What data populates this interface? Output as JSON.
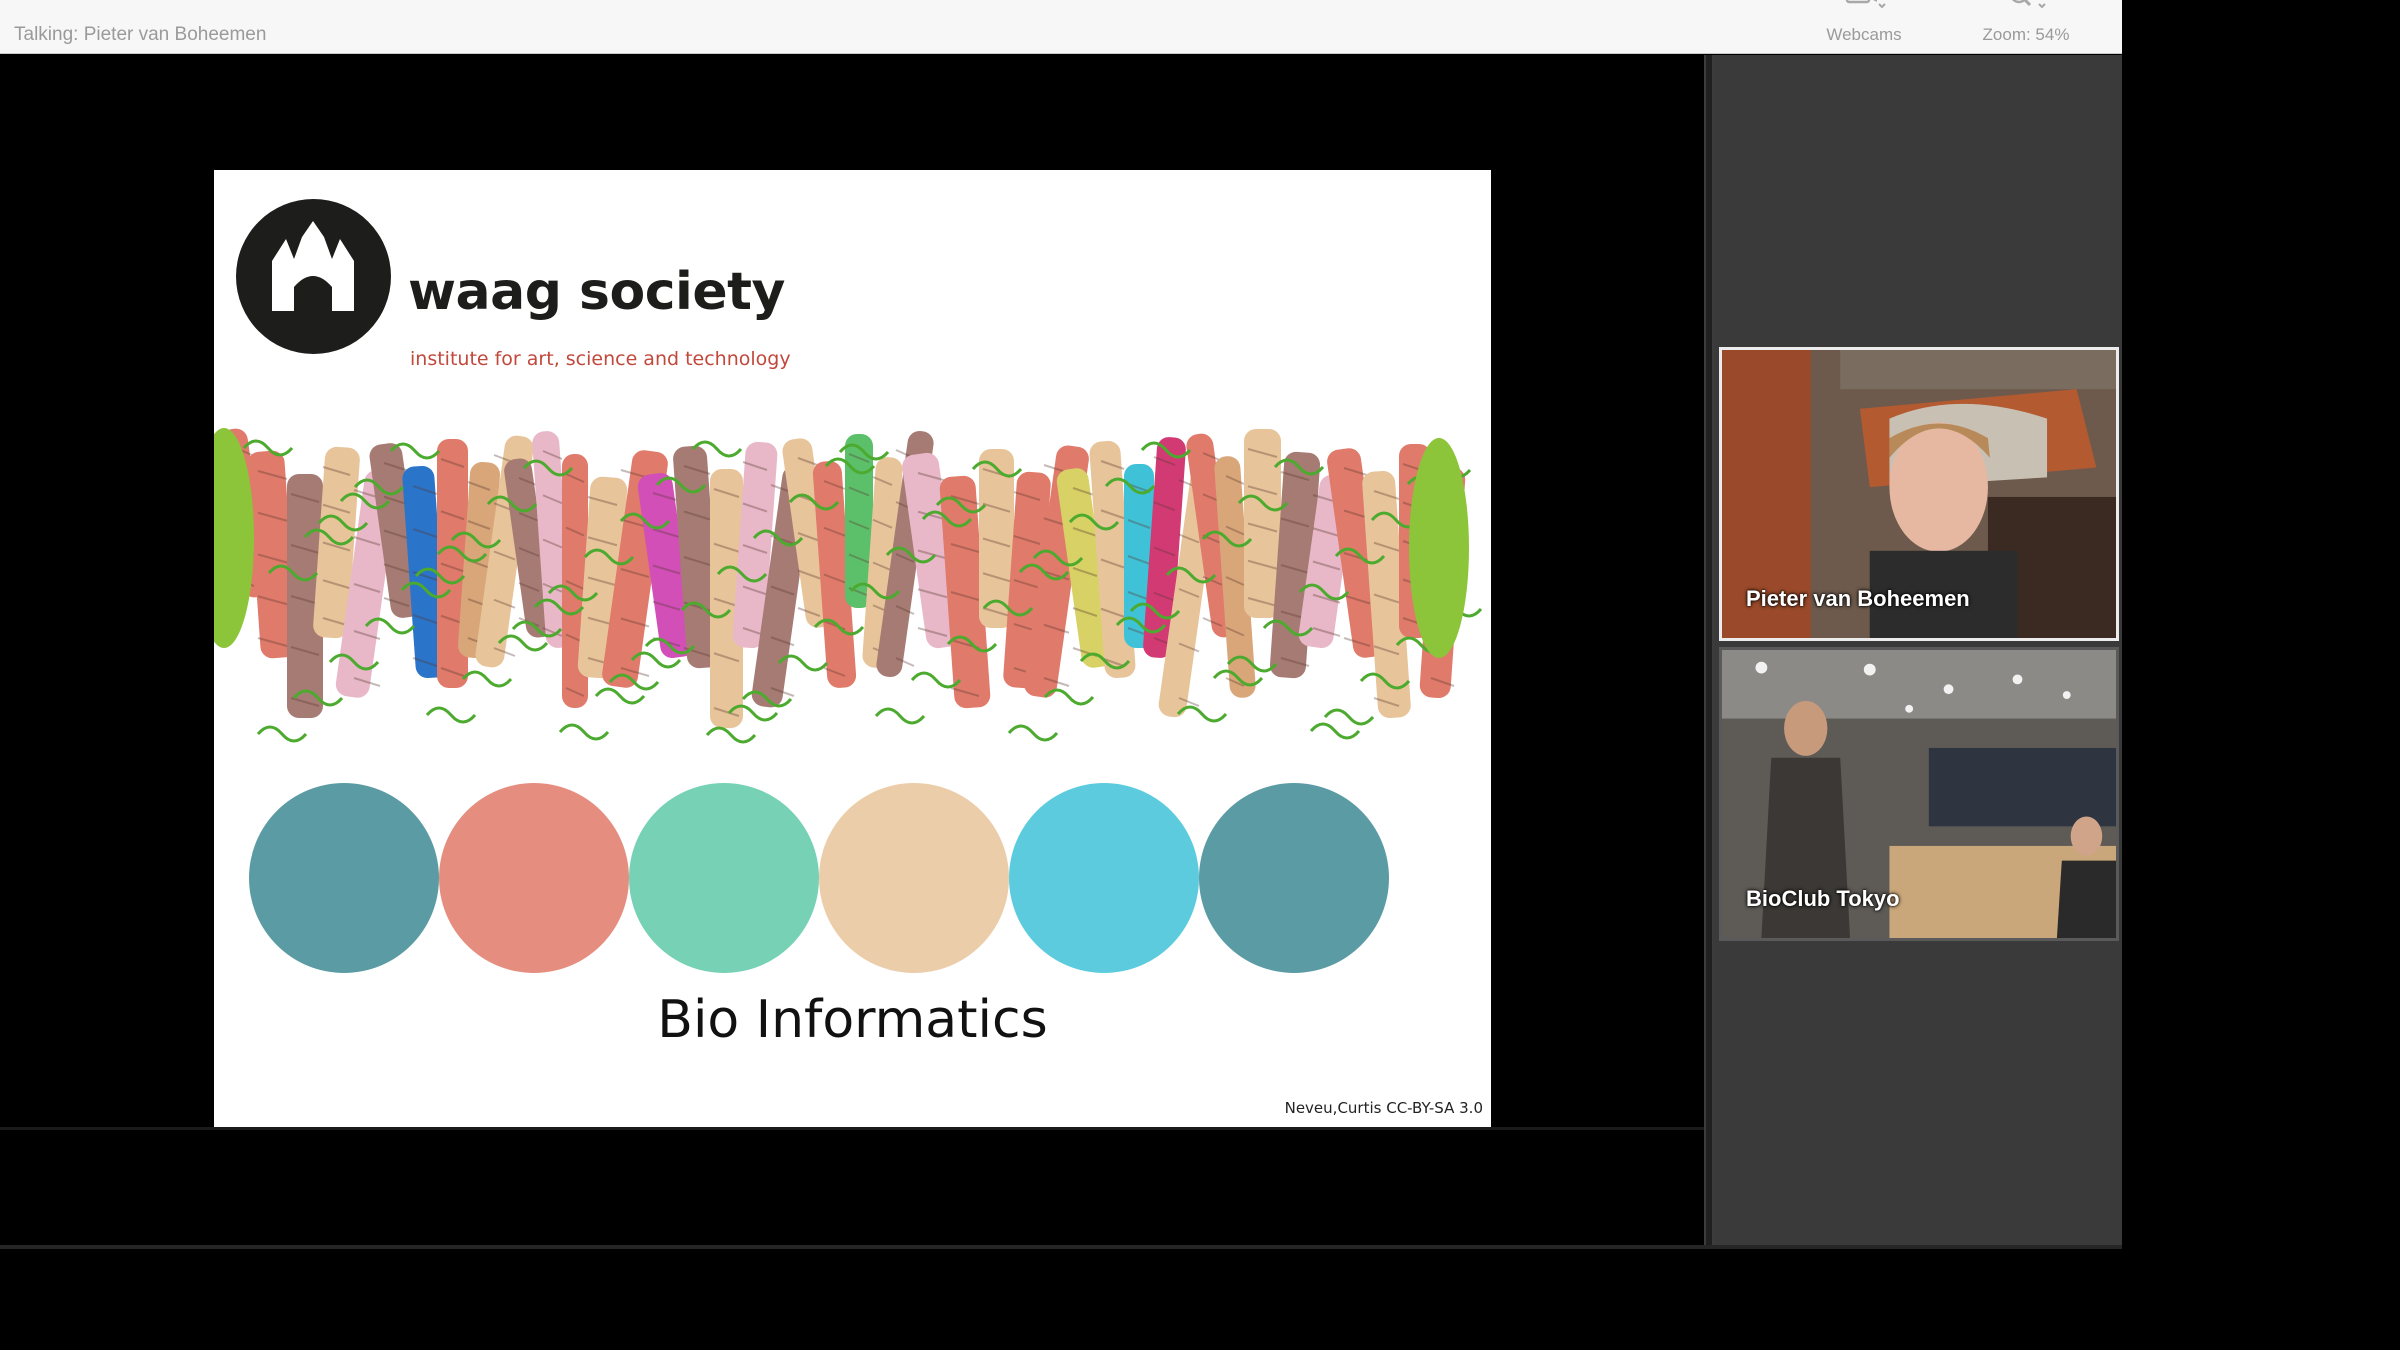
{
  "topbar": {
    "talking": "Talking: Pieter van Boheemen",
    "webcams_label": "Webcams",
    "zoom_label": "Zoom: 54%"
  },
  "slide": {
    "logo_name": "waag society",
    "logo_tagline": "institute for art, science and technology",
    "title": "Bio Informatics",
    "credit": "Neveu,Curtis CC-BY-SA 3.0"
  },
  "webcams": [
    {
      "name": "Pieter van Boheemen"
    },
    {
      "name": "BioClub Tokyo"
    }
  ],
  "icons": {
    "webcams": "camera-icon",
    "zoom": "magnifier-icon",
    "logo": "waag-building-icon"
  }
}
